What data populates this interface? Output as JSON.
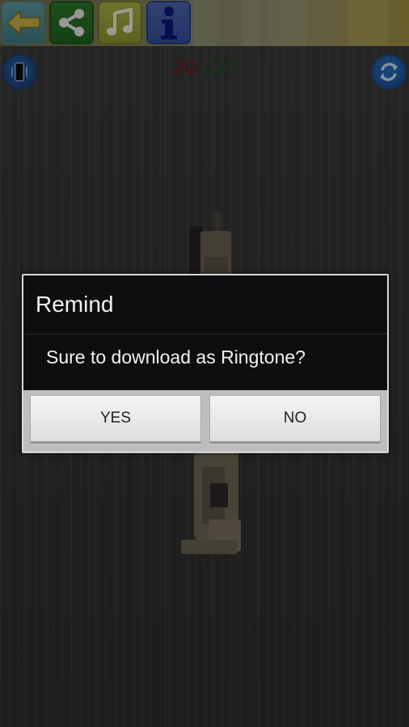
{
  "toolbar": {
    "icons": [
      "back-arrow-icon",
      "share-icon",
      "music-note-icon",
      "info-icon"
    ]
  },
  "ammo": {
    "current": "30",
    "total": " /30",
    "colors": {
      "current": "#6e1c1c",
      "total": "#1f4a1f"
    }
  },
  "corner_buttons": {
    "left_icon": "phone-vibrate-icon",
    "right_icon": "refresh-icon"
  },
  "dialog": {
    "title": "Remind",
    "message": "Sure to download as Ringtone?",
    "yes_label": "YES",
    "no_label": "NO"
  }
}
